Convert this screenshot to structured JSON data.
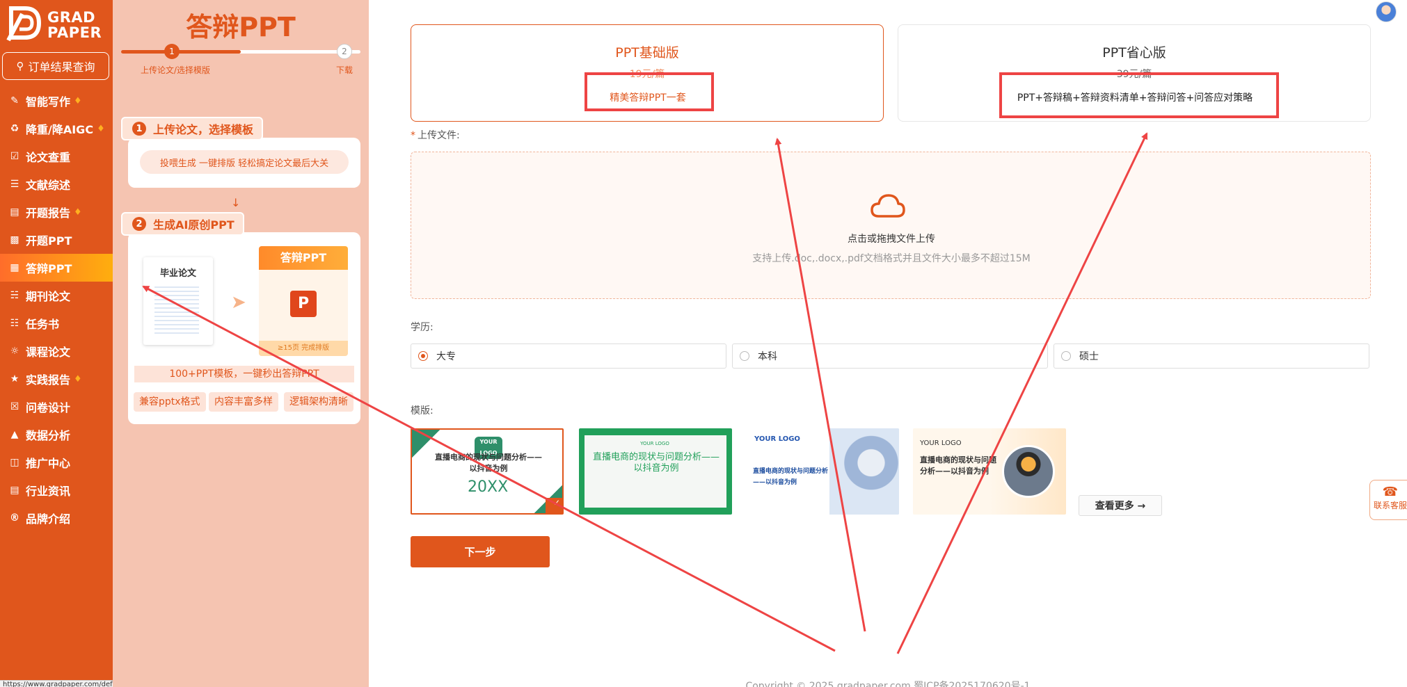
{
  "sidebar": {
    "logo_line1": "GRAD",
    "logo_line2": "PAPER",
    "order_button": "订单结果查询",
    "items": [
      {
        "label": "智能写作",
        "hot": true
      },
      {
        "label": "降重/降AIGC",
        "hot": true
      },
      {
        "label": "论文查重",
        "hot": false
      },
      {
        "label": "文献综述",
        "hot": false
      },
      {
        "label": "开题报告",
        "hot": true
      },
      {
        "label": "开题PPT",
        "hot": false
      },
      {
        "label": "答辩PPT",
        "hot": false,
        "active": true
      },
      {
        "label": "期刊论文",
        "hot": false
      },
      {
        "label": "任务书",
        "hot": false
      },
      {
        "label": "课程论文",
        "hot": false
      },
      {
        "label": "实践报告",
        "hot": true
      },
      {
        "label": "问卷设计",
        "hot": false
      },
      {
        "label": "数据分析",
        "hot": false
      },
      {
        "label": "推广中心",
        "hot": false
      },
      {
        "label": "行业资讯",
        "hot": false
      },
      {
        "label": "品牌介绍",
        "hot": false
      }
    ],
    "status_url": "https://www.gradpaper.com/defence-ppt"
  },
  "promo": {
    "title": "答辩PPT",
    "step1_num": "1",
    "step2_num": "2",
    "step1_label": "上传论文/选择模版",
    "step2_label": "下载",
    "card1_tag": "上传论文，选择模板",
    "card1_pill": "投喂生成  一键排版  轻松搞定论文最后大关",
    "card2_tag": "生成AI原创PPT",
    "thesis_title": "毕业论文",
    "answer_title": "答辩PPT",
    "answer_badge": "≥15页 完成排版",
    "banner": "100+PPT模板，一键秒出答辩PPT",
    "chips": [
      "兼容pptx格式",
      "内容丰富多样",
      "逻辑架构清晰"
    ]
  },
  "plans": {
    "basic": {
      "name": "PPT基础版",
      "price": "19元/篇",
      "desc": "精美答辩PPT一套"
    },
    "pro": {
      "name": "PPT省心版",
      "price": "39元/篇",
      "desc": "PPT+答辩稿+答辩资料清单+答辩问答+问答应对策略"
    }
  },
  "upload": {
    "label": "上传文件:",
    "required_mark": "*",
    "hint": "点击或拖拽文件上传",
    "sub": "支持上传.doc,.docx,.pdf文档格式并且文件大小最多不超过15M"
  },
  "education": {
    "label": "学历:",
    "options": [
      "大专",
      "本科",
      "硕士"
    ],
    "selected": "大专"
  },
  "templates": {
    "label": "模版:",
    "items": [
      {
        "logo": "YOUR LOGO",
        "title": "直播电商的现状与问题分析——以抖音为例",
        "extra": "20XX"
      },
      {
        "logo": "YOUR LOGO",
        "title": "直播电商的现状与问题分析——以抖音为例"
      },
      {
        "logo": "YOUR LOGO",
        "title": "直播电商的现状与问题分析——以抖音为例"
      },
      {
        "logo": "YOUR LOGO",
        "title": "直播电商的现状与问题分析——以抖音为例"
      }
    ],
    "see_more": "查看更多 →"
  },
  "next_button": "下一步",
  "copyright": "Copyright © 2025 gradpaper.com 蜀ICP备2025170620号-1",
  "service_button": "联系客服",
  "colors": {
    "brand": "#e0561c",
    "annotation": "#ee4444"
  }
}
